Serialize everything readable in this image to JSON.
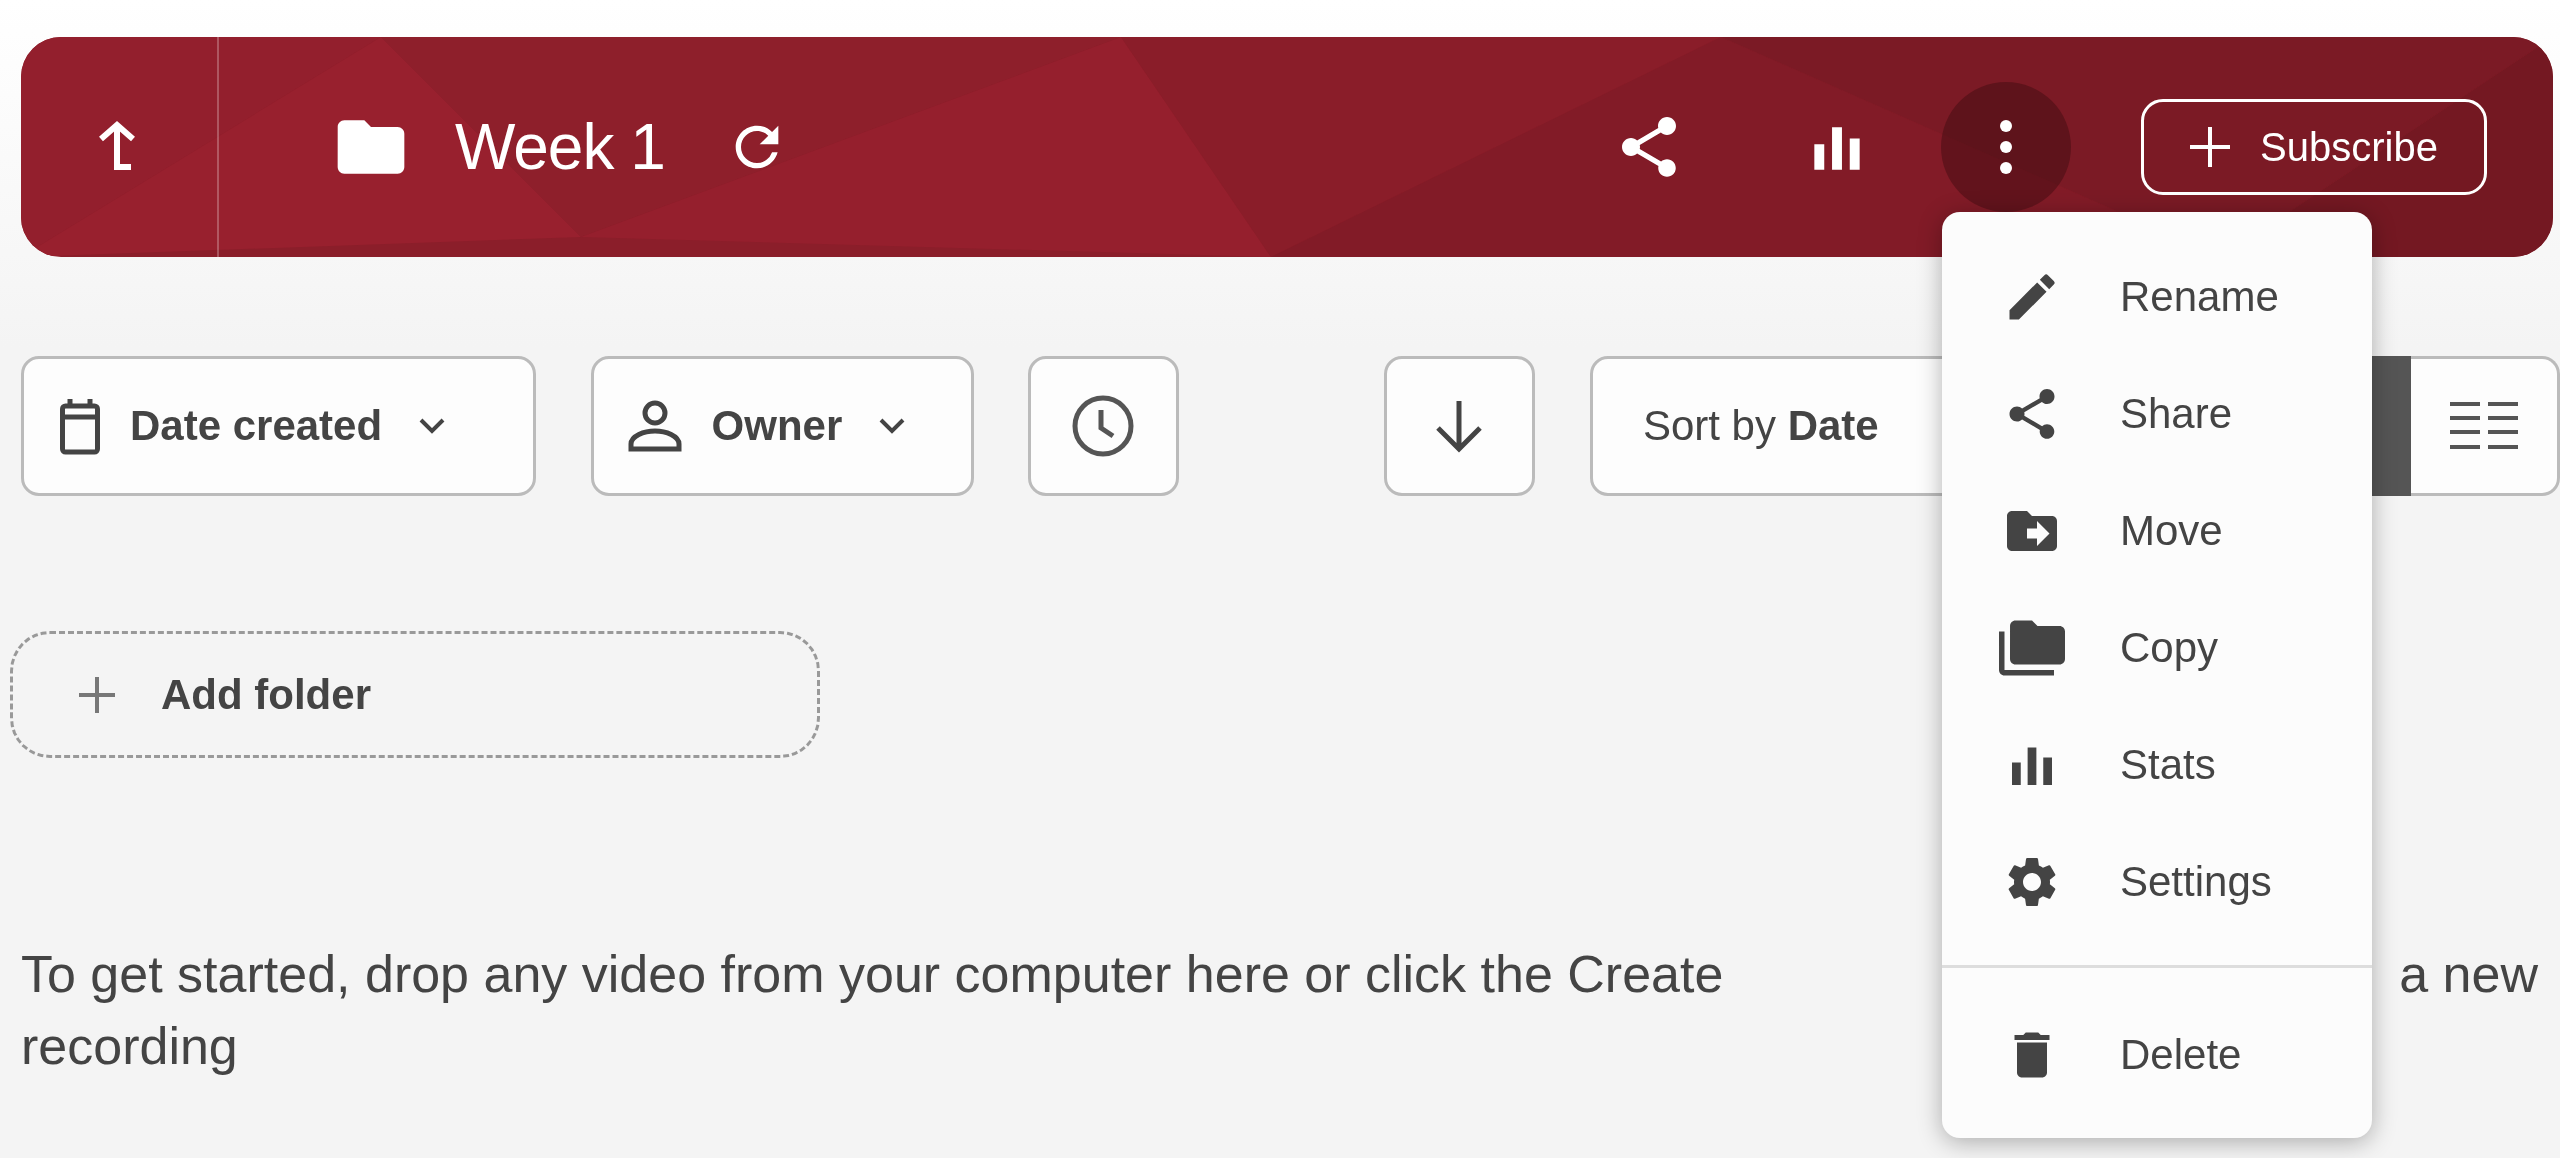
{
  "header": {
    "title": "Week 1",
    "more_active": true,
    "subscribe": {
      "label": "Subscribe"
    }
  },
  "filters": [
    {
      "kind": "date",
      "label": "Date created"
    },
    {
      "kind": "owner",
      "label": "Owner"
    },
    {
      "kind": "time"
    }
  ],
  "sort": {
    "label": "Sort by **Date**"
  },
  "views": [
    {
      "kind": "grid",
      "selected": true
    },
    {
      "kind": "list",
      "selected": false
    }
  ],
  "add_folder": {
    "label": "Add folder"
  },
  "empty_message": {
    "line_start": "To get started, drop any video from your computer here or click the Create",
    "line_end": "a new",
    "line_2": "recording"
  },
  "menu": {
    "groups": [
      [
        {
          "kind": "rename",
          "label": "Rename"
        },
        {
          "kind": "share",
          "label": "Share"
        },
        {
          "kind": "move",
          "label": "Move"
        },
        {
          "kind": "copy",
          "label": "Copy"
        },
        {
          "kind": "stats",
          "label": "Stats"
        },
        {
          "kind": "settings",
          "label": "Settings"
        }
      ],
      [
        {
          "kind": "delete",
          "label": "Delete"
        }
      ]
    ]
  }
}
